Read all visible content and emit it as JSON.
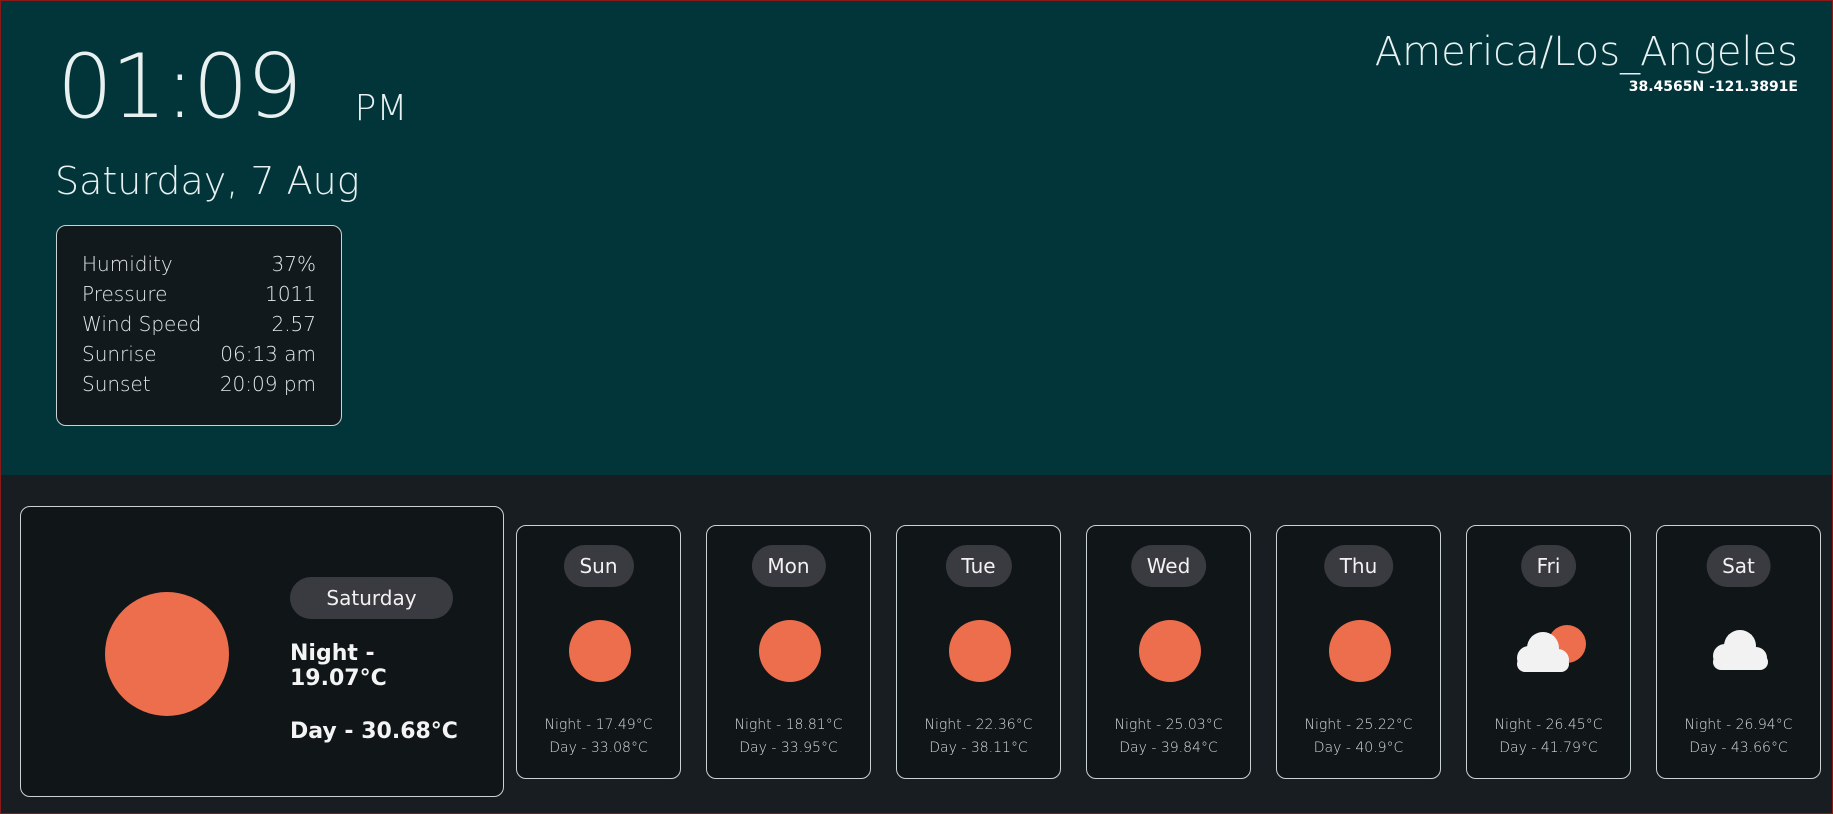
{
  "clock": {
    "time": "01:09",
    "ampm": "PM",
    "date": "Saturday, 7 Aug"
  },
  "details": [
    {
      "label": "Humidity",
      "value": "37%"
    },
    {
      "label": "Pressure",
      "value": "1011"
    },
    {
      "label": "Wind Speed",
      "value": "2.57"
    },
    {
      "label": "Sunrise",
      "value": "06:13 am"
    },
    {
      "label": "Sunset",
      "value": "20:09 pm"
    }
  ],
  "location": {
    "timezone": "America/Los_Angeles",
    "coords": "38.4565N -121.3891E"
  },
  "today": {
    "day": "Saturday",
    "night": "Night - 19.07°C",
    "day_temp": "Day - 30.68°C",
    "icon": "sun-icon"
  },
  "forecast": [
    {
      "day": "Sun",
      "night": "Night - 17.49°C",
      "day_temp": "Day - 33.08°C",
      "icon": "sun-icon"
    },
    {
      "day": "Mon",
      "night": "Night - 18.81°C",
      "day_temp": "Day - 33.95°C",
      "icon": "sun-icon"
    },
    {
      "day": "Tue",
      "night": "Night - 22.36°C",
      "day_temp": "Day - 38.11°C",
      "icon": "sun-icon"
    },
    {
      "day": "Wed",
      "night": "Night - 25.03°C",
      "day_temp": "Day - 39.84°C",
      "icon": "sun-icon"
    },
    {
      "day": "Thu",
      "night": "Night - 25.22°C",
      "day_temp": "Day - 40.9°C",
      "icon": "sun-icon"
    },
    {
      "day": "Fri",
      "night": "Night - 26.45°C",
      "day_temp": "Day - 41.79°C",
      "icon": "partly-cloudy-icon"
    },
    {
      "day": "Sat",
      "night": "Night - 26.94°C",
      "day_temp": "Day - 43.66°C",
      "icon": "cloud-icon"
    }
  ],
  "colors": {
    "top_bg": "#01353a",
    "bottom_bg": "#171d21",
    "sun": "#ec6e4c",
    "pill": "#3a3b40"
  }
}
